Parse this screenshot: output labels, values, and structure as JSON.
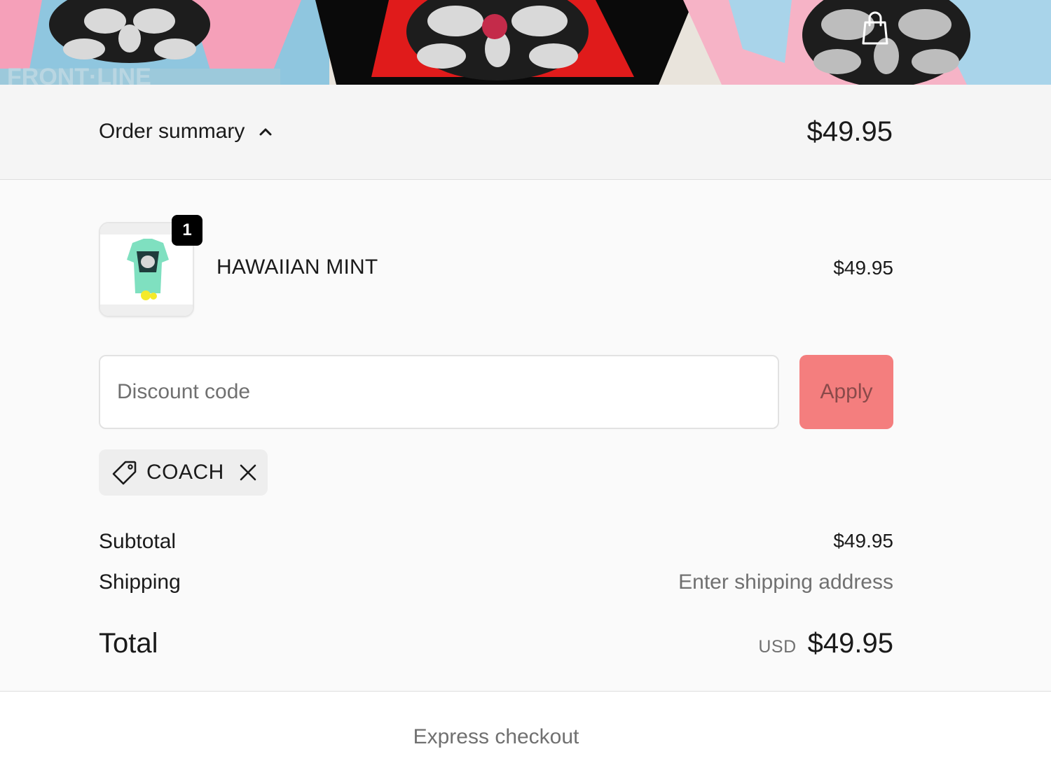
{
  "header": {
    "banner_image": "gorilla-print-tshirts-banner",
    "cart_icon": "shopping-bag-icon"
  },
  "summary_toggle": {
    "label": "Order summary",
    "icon": "chevron-up-icon",
    "total": "$49.95"
  },
  "cart": {
    "items": [
      {
        "name": "HAWAIIAN MINT",
        "price": "$49.95",
        "quantity": "1",
        "thumbnail": "mint-shirt-thumbnail"
      }
    ]
  },
  "discount": {
    "placeholder": "Discount code",
    "value": "",
    "apply_label": "Apply",
    "applied_code": "COACH",
    "tag_icon": "tag-icon",
    "remove_icon": "close-icon"
  },
  "totals": {
    "subtotal_label": "Subtotal",
    "subtotal_value": "$49.95",
    "shipping_label": "Shipping",
    "shipping_value": "Enter shipping address",
    "total_label": "Total",
    "currency": "USD",
    "total_value": "$49.95"
  },
  "express": {
    "heading": "Express checkout"
  },
  "colors": {
    "apply_button": "#f47e7e",
    "summary_bar_bg": "#f5f5f5",
    "summary_body_bg": "#fafafa",
    "badge": "#000000",
    "muted_text": "#707070"
  }
}
